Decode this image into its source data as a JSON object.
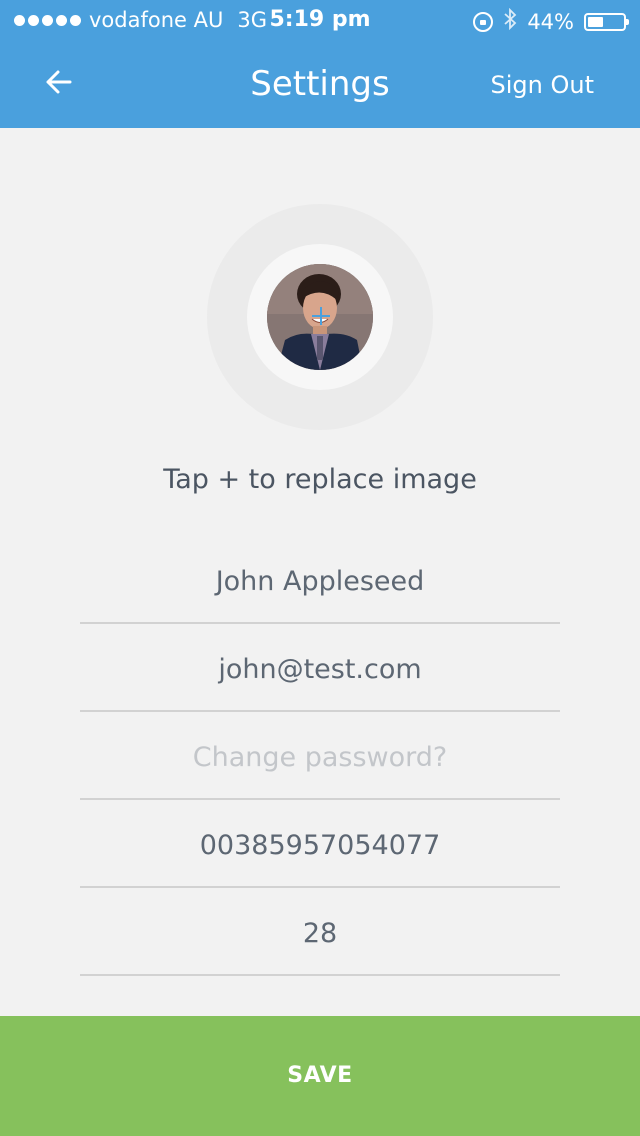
{
  "status_bar": {
    "carrier": "vodafone AU",
    "network": "3G",
    "time": "5:19 pm",
    "battery": "44%",
    "battery_level": 0.44
  },
  "header": {
    "title": "Settings",
    "sign_out_label": "Sign Out",
    "back_icon": "arrow-left-icon",
    "bg_color": "#4aa0dd"
  },
  "profile": {
    "hint": "Tap + to replace image"
  },
  "form": {
    "name": "John Appleseed",
    "email": "john@test.com",
    "password_placeholder": "Change password?",
    "phone": "00385957054077",
    "age": "28"
  },
  "save_button": {
    "label": "SAVE",
    "color": "#86c15c"
  }
}
